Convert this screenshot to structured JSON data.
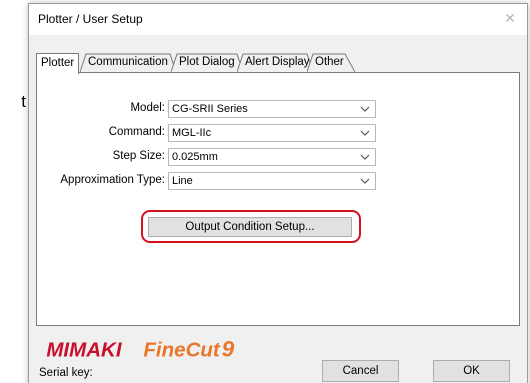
{
  "background": {
    "partial_text": "t"
  },
  "window": {
    "title": "Plotter / User Setup",
    "close_glyph": "✕"
  },
  "tabs": [
    {
      "label": "Plotter",
      "active": true
    },
    {
      "label": "Communication",
      "active": false
    },
    {
      "label": "Plot Dialog",
      "active": false
    },
    {
      "label": "Alert Display",
      "active": false
    },
    {
      "label": "Other",
      "active": false
    }
  ],
  "fields": {
    "model": {
      "label": "Model:",
      "value": "CG-SRII Series"
    },
    "command": {
      "label": "Command:",
      "value": "MGL-IIc"
    },
    "step_size": {
      "label": "Step Size:",
      "value": "0.025mm"
    },
    "approximation_type": {
      "label": "Approximation Type:",
      "value": "Line"
    }
  },
  "output_condition_button": "Output Condition Setup...",
  "footer": {
    "logo_text": {
      "brand": "MIMAKI",
      "product": "FineCut",
      "version": "9"
    },
    "serial_key_label": "Serial key:",
    "cancel_label": "Cancel",
    "ok_label": "OK"
  },
  "colors": {
    "highlight": "#d7101e",
    "logo_brand": "#c8102e",
    "logo_product": "#e8772e"
  }
}
